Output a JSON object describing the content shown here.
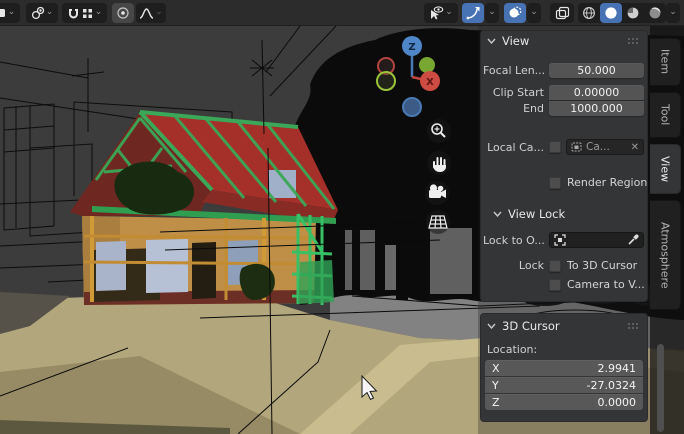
{
  "colors": {
    "accent_blue": "#4772b3",
    "panel_bg": "#333537",
    "field_bg": "#545454",
    "viewport_bg": "#3c3c3c",
    "gizmo_x_red": "#cc4b42",
    "gizmo_z_blue": "#4e86c8"
  },
  "header": {
    "icons_left": [
      "orientation-dropdown",
      "pivot-point",
      "snap-magnet",
      "snap-target-grid",
      "proportional-editing",
      "proportional-falloff"
    ],
    "icons_right": [
      "object-type-visibility",
      "show-gizmos",
      "show-overlays",
      "toggle-xray",
      "shading-wireframe",
      "shading-solid",
      "shading-material",
      "shading-rendered"
    ]
  },
  "viewport": {
    "gizmo": {
      "z_label": "Z",
      "x_label": "X"
    }
  },
  "sidebar": {
    "tabs": [
      {
        "label": "Item"
      },
      {
        "label": "Tool"
      },
      {
        "label": "View"
      },
      {
        "label": "Atmosphere"
      }
    ],
    "view_panel": {
      "title": "View",
      "focal_label": "Focal Len...",
      "focal_value": "50.000",
      "clip_start_label": "Clip Start",
      "clip_start_value": "0.00000",
      "clip_end_label": "End",
      "clip_end_value": "1000.000",
      "local_camera_label": "Local Ca...",
      "local_camera_value": "Ca...",
      "local_camera_clear": "✕",
      "render_region_label": "Render Region",
      "view_lock_title": "View Lock",
      "lock_to_object_label": "Lock to O...",
      "lock_label": "Lock",
      "to_3d_cursor_label": "To 3D Cursor",
      "camera_to_view_label": "Camera to V..."
    },
    "cursor_panel": {
      "title": "3D Cursor",
      "location_label": "Location:",
      "rows": [
        {
          "axis": "X",
          "value": "2.9941"
        },
        {
          "axis": "Y",
          "value": "-27.0324"
        },
        {
          "axis": "Z",
          "value": "0.0000"
        }
      ]
    }
  }
}
